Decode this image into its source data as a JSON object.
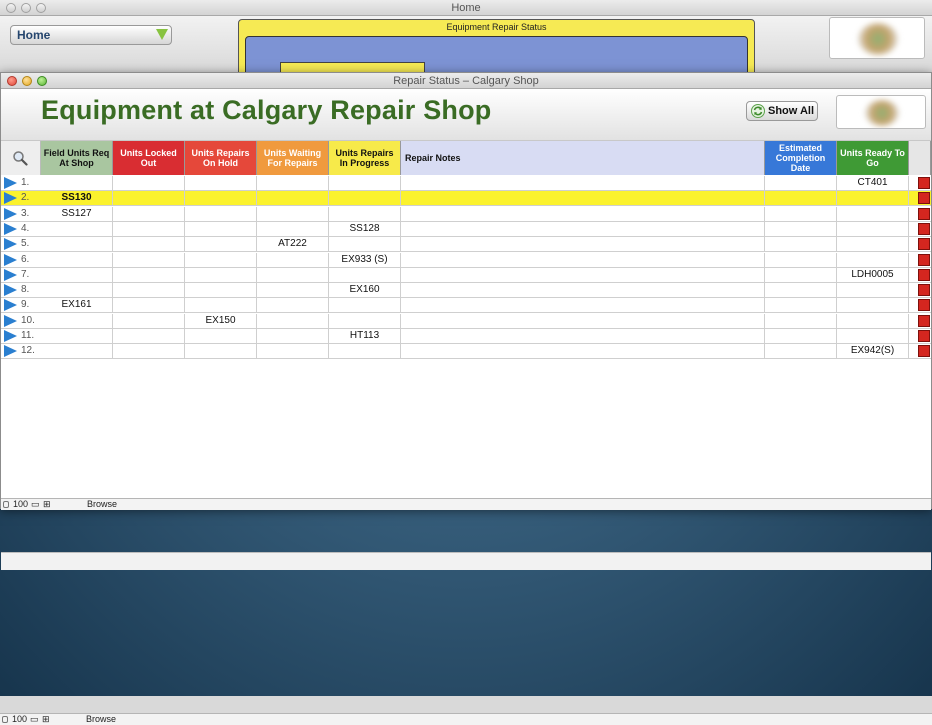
{
  "home_window": {
    "title": "Home",
    "nav_label": "Home",
    "panel_title": "Equipment Repair Status",
    "status": {
      "zoom": "100",
      "mode": "Browse"
    }
  },
  "repair_window": {
    "title": "Repair Status – Calgary Shop",
    "page_title": "Equipment at Calgary Repair Shop",
    "show_all_label": "Show All",
    "status": {
      "zoom": "100",
      "mode": "Browse"
    }
  },
  "table": {
    "columns": [
      {
        "label": "Field Units Req At Shop",
        "bg": "#a9c6a0",
        "color": "#111111"
      },
      {
        "label": "Units Locked Out",
        "bg": "#d92d32",
        "color": "#ffffff"
      },
      {
        "label": "Units Repairs On Hold",
        "bg": "#e5483a",
        "color": "#ffffff"
      },
      {
        "label": "Units Waiting For Repairs",
        "bg": "#f09a3e",
        "color": "#ffffff"
      },
      {
        "label": "Units Repairs In Progress",
        "bg": "#f7ea4a",
        "color": "#111111"
      },
      {
        "label": "Repair Notes",
        "bg": "#d8dcf3",
        "color": "#111111"
      },
      {
        "label": "Estimated Completion Date",
        "bg": "#3778d8",
        "color": "#ffffff"
      },
      {
        "label": "Units Ready To Go",
        "bg": "#3f9a35",
        "color": "#ffffff"
      }
    ],
    "rows": [
      {
        "num": "1.",
        "cells": [
          "",
          "",
          "",
          "",
          "",
          "",
          "",
          "CT401"
        ]
      },
      {
        "num": "2.",
        "cells": [
          "SS130",
          "",
          "",
          "",
          "",
          "",
          "",
          ""
        ],
        "selected": true
      },
      {
        "num": "3.",
        "cells": [
          "SS127",
          "",
          "",
          "",
          "",
          "",
          "",
          ""
        ]
      },
      {
        "num": "4.",
        "cells": [
          "",
          "",
          "",
          "",
          "SS128",
          "",
          "",
          ""
        ]
      },
      {
        "num": "5.",
        "cells": [
          "",
          "",
          "",
          "AT222",
          "",
          "",
          "",
          ""
        ]
      },
      {
        "num": "6.",
        "cells": [
          "",
          "",
          "",
          "",
          "EX933 (S)",
          "",
          "",
          ""
        ]
      },
      {
        "num": "7.",
        "cells": [
          "",
          "",
          "",
          "",
          "",
          "",
          "",
          "LDH0005"
        ]
      },
      {
        "num": "8.",
        "cells": [
          "",
          "",
          "",
          "",
          "EX160",
          "",
          "",
          ""
        ]
      },
      {
        "num": "9.",
        "cells": [
          "EX161",
          "",
          "",
          "",
          "",
          "",
          "",
          ""
        ]
      },
      {
        "num": "10.",
        "cells": [
          "",
          "",
          "EX150",
          "",
          "",
          "",
          "",
          ""
        ]
      },
      {
        "num": "11.",
        "cells": [
          "",
          "",
          "",
          "",
          "HT113",
          "",
          "",
          ""
        ]
      },
      {
        "num": "12.",
        "cells": [
          "",
          "",
          "",
          "",
          "",
          "",
          "",
          "EX942(S)"
        ]
      }
    ]
  },
  "icons": {
    "search": "magnifier-icon",
    "refresh": "refresh-icon",
    "row_arrow": "triangle-right-icon",
    "delete": "red-square-delete-icon"
  },
  "colors": {
    "title_green": "#3a6c24",
    "selected_row": "#fbf22d",
    "row_arrow": "#2a7fd0",
    "delete_red": "#d4261f"
  }
}
